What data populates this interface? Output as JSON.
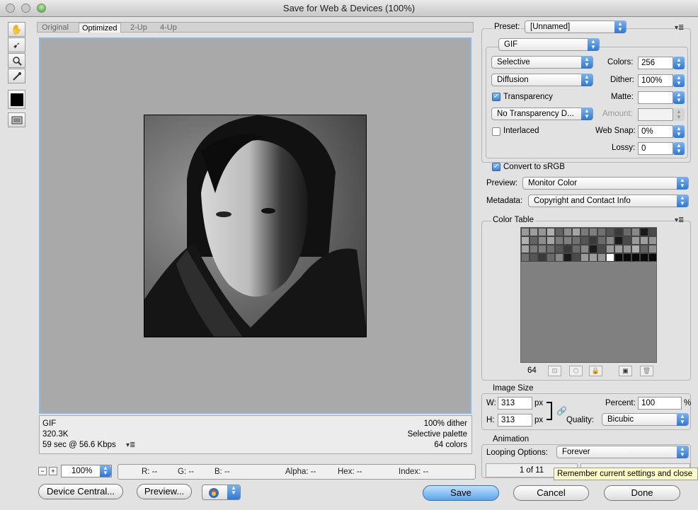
{
  "window": {
    "title": "Save for Web & Devices (100%)"
  },
  "tabs": [
    "Original",
    "Optimized",
    "2-Up",
    "4-Up"
  ],
  "info_left": {
    "format": "GIF",
    "size": "320.3K",
    "time": "59 sec @ 56.6 Kbps"
  },
  "info_right": {
    "dither": "100% dither",
    "palette": "Selective palette",
    "colors": "64 colors"
  },
  "status": {
    "zoom": "100%",
    "r": "R: --",
    "g": "G: --",
    "b": "B: --",
    "alpha": "Alpha: --",
    "hex": "Hex: --",
    "index": "Index: --"
  },
  "buttons": {
    "device_central": "Device Central...",
    "preview": "Preview...",
    "save": "Save",
    "cancel": "Cancel",
    "done": "Done"
  },
  "preset": {
    "label": "Preset:",
    "value": "[Unnamed]"
  },
  "format": "GIF",
  "reduction": "Selective",
  "dither_algo": "Diffusion",
  "transparency": {
    "label": "Transparency",
    "checked": true
  },
  "transparency_dither": "No Transparency D...",
  "interlaced": {
    "label": "Interlaced",
    "checked": false
  },
  "colors": {
    "label": "Colors:",
    "value": "256"
  },
  "dither": {
    "label": "Dither:",
    "value": "100%"
  },
  "matte": {
    "label": "Matte:",
    "value": ""
  },
  "amount": {
    "label": "Amount:",
    "value": ""
  },
  "web_snap": {
    "label": "Web Snap:",
    "value": "0%"
  },
  "lossy": {
    "label": "Lossy:",
    "value": "0"
  },
  "convert_srgb": {
    "label": "Convert to sRGB",
    "checked": true
  },
  "preview": {
    "label": "Preview:",
    "value": "Monitor Color"
  },
  "metadata": {
    "label": "Metadata:",
    "value": "Copyright and Contact Info"
  },
  "color_table": {
    "title": "Color Table",
    "count": "64"
  },
  "image_size": {
    "title": "Image Size",
    "w_label": "W:",
    "w": "313",
    "h_label": "H:",
    "h": "313",
    "unit": "px",
    "percent_label": "Percent:",
    "percent": "100",
    "percent_unit": "%",
    "quality_label": "Quality:",
    "quality": "Bicubic"
  },
  "animation": {
    "title": "Animation",
    "looping_label": "Looping Options:",
    "looping": "Forever",
    "frame": "1 of 11"
  },
  "tooltip": "Remember current settings and close",
  "colors_accent": {
    "focus": "#8eb6e0",
    "button_blue": "#5aa6ec"
  }
}
